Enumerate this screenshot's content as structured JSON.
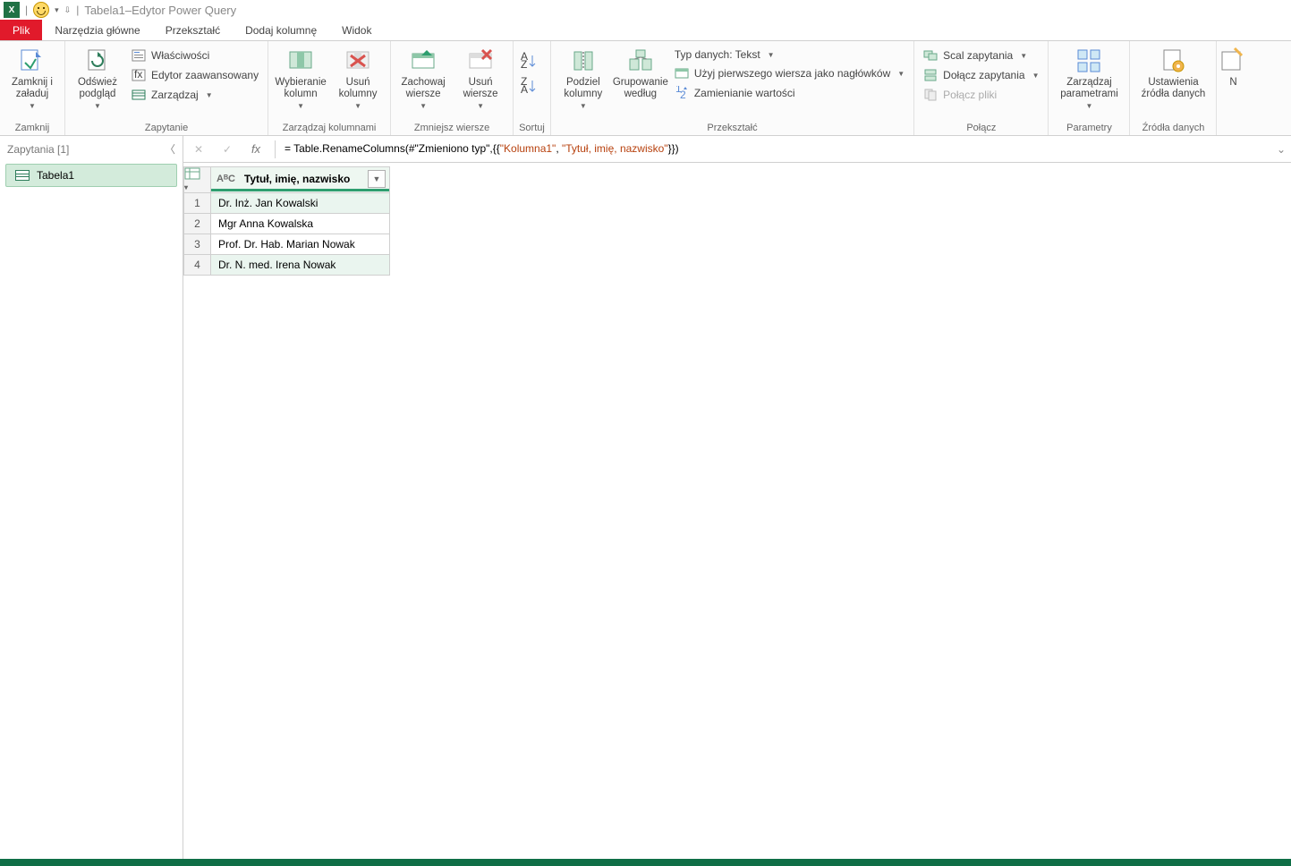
{
  "title": "Tabela1–Edytor Power Query",
  "tabs": {
    "file": "Plik",
    "home": "Narzędzia główne",
    "transform": "Przekształć",
    "addcol": "Dodaj kolumnę",
    "view": "Widok"
  },
  "ribbon": {
    "close": {
      "label": "Zamknij i\nzaładuj",
      "group": "Zamknij"
    },
    "query": {
      "refresh": "Odśwież\npodgląd",
      "properties": "Właściwości",
      "advanced": "Edytor zaawansowany",
      "manage": "Zarządzaj",
      "group": "Zapytanie"
    },
    "cols": {
      "choose": "Wybieranie\nkolumn",
      "remove": "Usuń\nkolumny",
      "group": "Zarządzaj kolumnami"
    },
    "rows": {
      "keep": "Zachowaj\nwiersze",
      "remove": "Usuń\nwiersze",
      "group": "Zmniejsz wiersze"
    },
    "sort": {
      "group": "Sortuj"
    },
    "transform": {
      "split": "Podziel\nkolumny",
      "groupby": "Grupowanie\nwedług",
      "datatype": "Typ danych: Tekst",
      "firstrow": "Użyj pierwszego wiersza jako nagłówków",
      "replace": "Zamienianie wartości",
      "group": "Przekształć"
    },
    "combine": {
      "merge": "Scal zapytania",
      "append": "Dołącz zapytania",
      "files": "Połącz pliki",
      "group": "Połącz"
    },
    "params": {
      "label": "Zarządzaj\nparametrami",
      "group": "Parametry"
    },
    "sources": {
      "label": "Ustawienia\nźródła danych",
      "group": "Źródła danych"
    },
    "new": {
      "label": "N"
    }
  },
  "queries": {
    "header": "Zapytania [1]",
    "items": [
      "Tabela1"
    ]
  },
  "formula": {
    "prefix": "= Table.RenameColumns(#\"Zmieniono typ\",{{",
    "str1": "\"Kolumna1\"",
    "mid": ", ",
    "str2": "\"Tytuł, imię, nazwisko\"",
    "suffix": "}})"
  },
  "grid": {
    "column": "Tytuł, imię, nazwisko",
    "type_icon": "AᴮC",
    "rows": [
      "Dr. Inż. Jan Kowalski",
      "Mgr Anna Kowalska",
      "Prof. Dr. Hab. Marian Nowak",
      "Dr. N. med. Irena Nowak"
    ]
  }
}
